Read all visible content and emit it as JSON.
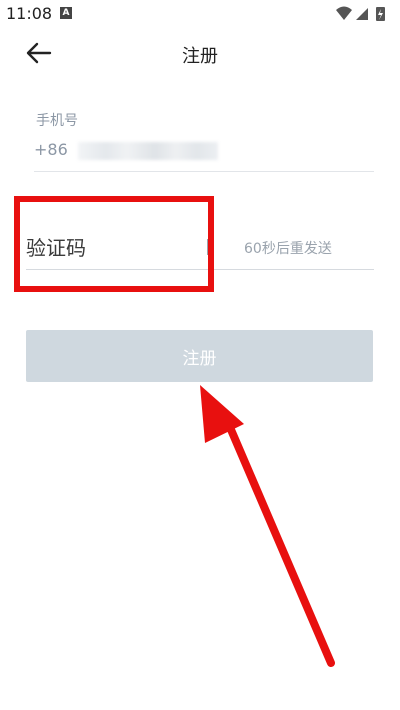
{
  "status_bar": {
    "time": "11:08",
    "notification_letter": "A",
    "icons": [
      "wifi-icon",
      "signal-icon",
      "battery-charging-icon"
    ]
  },
  "app_bar": {
    "title": "注册",
    "back_icon": "back-arrow-icon"
  },
  "form": {
    "phone_label": "手机号",
    "phone_prefix": "+86",
    "code_placeholder": "验证码",
    "code_value": "",
    "resend_text": "60秒后重发送",
    "register_label": "注册",
    "register_enabled": false
  },
  "colors": {
    "accent_highlight": "#e8100f",
    "button_disabled": "#cfd8df",
    "label_gray": "#8c97a5"
  }
}
